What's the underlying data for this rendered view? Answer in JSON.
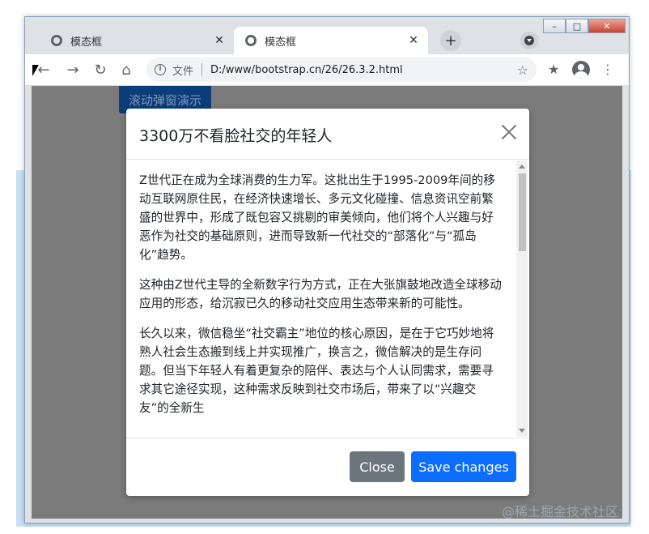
{
  "tabs": [
    {
      "label": "模态框",
      "active": false
    },
    {
      "label": "模态框",
      "active": true
    }
  ],
  "toolbar": {
    "omnibox_file_label": "文件",
    "url": "D:/www/bootstrap.cn/26/26.3.2.html"
  },
  "page": {
    "trigger_button": "滚动弹窗演示"
  },
  "modal": {
    "title": "3300万不看脸社交的年轻人",
    "paragraphs": [
      "Z世代正在成为全球消费的生力军。这批出生于1995-2009年间的移动互联网原住民，在经济快速增长、多元文化碰撞、信息资讯空前繁盛的世界中，形成了既包容又挑剔的审美倾向，他们将个人兴趣与好恶作为社交的基础原则，进而导致新一代社交的“部落化”与“孤岛化”趋势。",
      "这种由Z世代主导的全新数字行为方式，正在大张旗鼓地改造全球移动应用的形态，给沉寂已久的移动社交应用生态带来新的可能性。",
      "长久以来，微信稳坐“社交霸主”地位的核心原因，是在于它巧妙地将熟人社会生态搬到线上并实现推广，换言之，微信解决的是生存问题。但当下年轻人有着更复杂的陪伴、表达与个人认同需求，需要寻求其它途径实现，这种需求反映到社交市场后，带来了以“兴趣交友”的全新生"
    ],
    "close_label": "Close",
    "save_label": "Save changes"
  },
  "watermark": "@稀土掘金技术社区",
  "colors": {
    "primary": "#0d6efd",
    "secondary": "#6c757d",
    "backdrop": "#7b7b7b"
  }
}
